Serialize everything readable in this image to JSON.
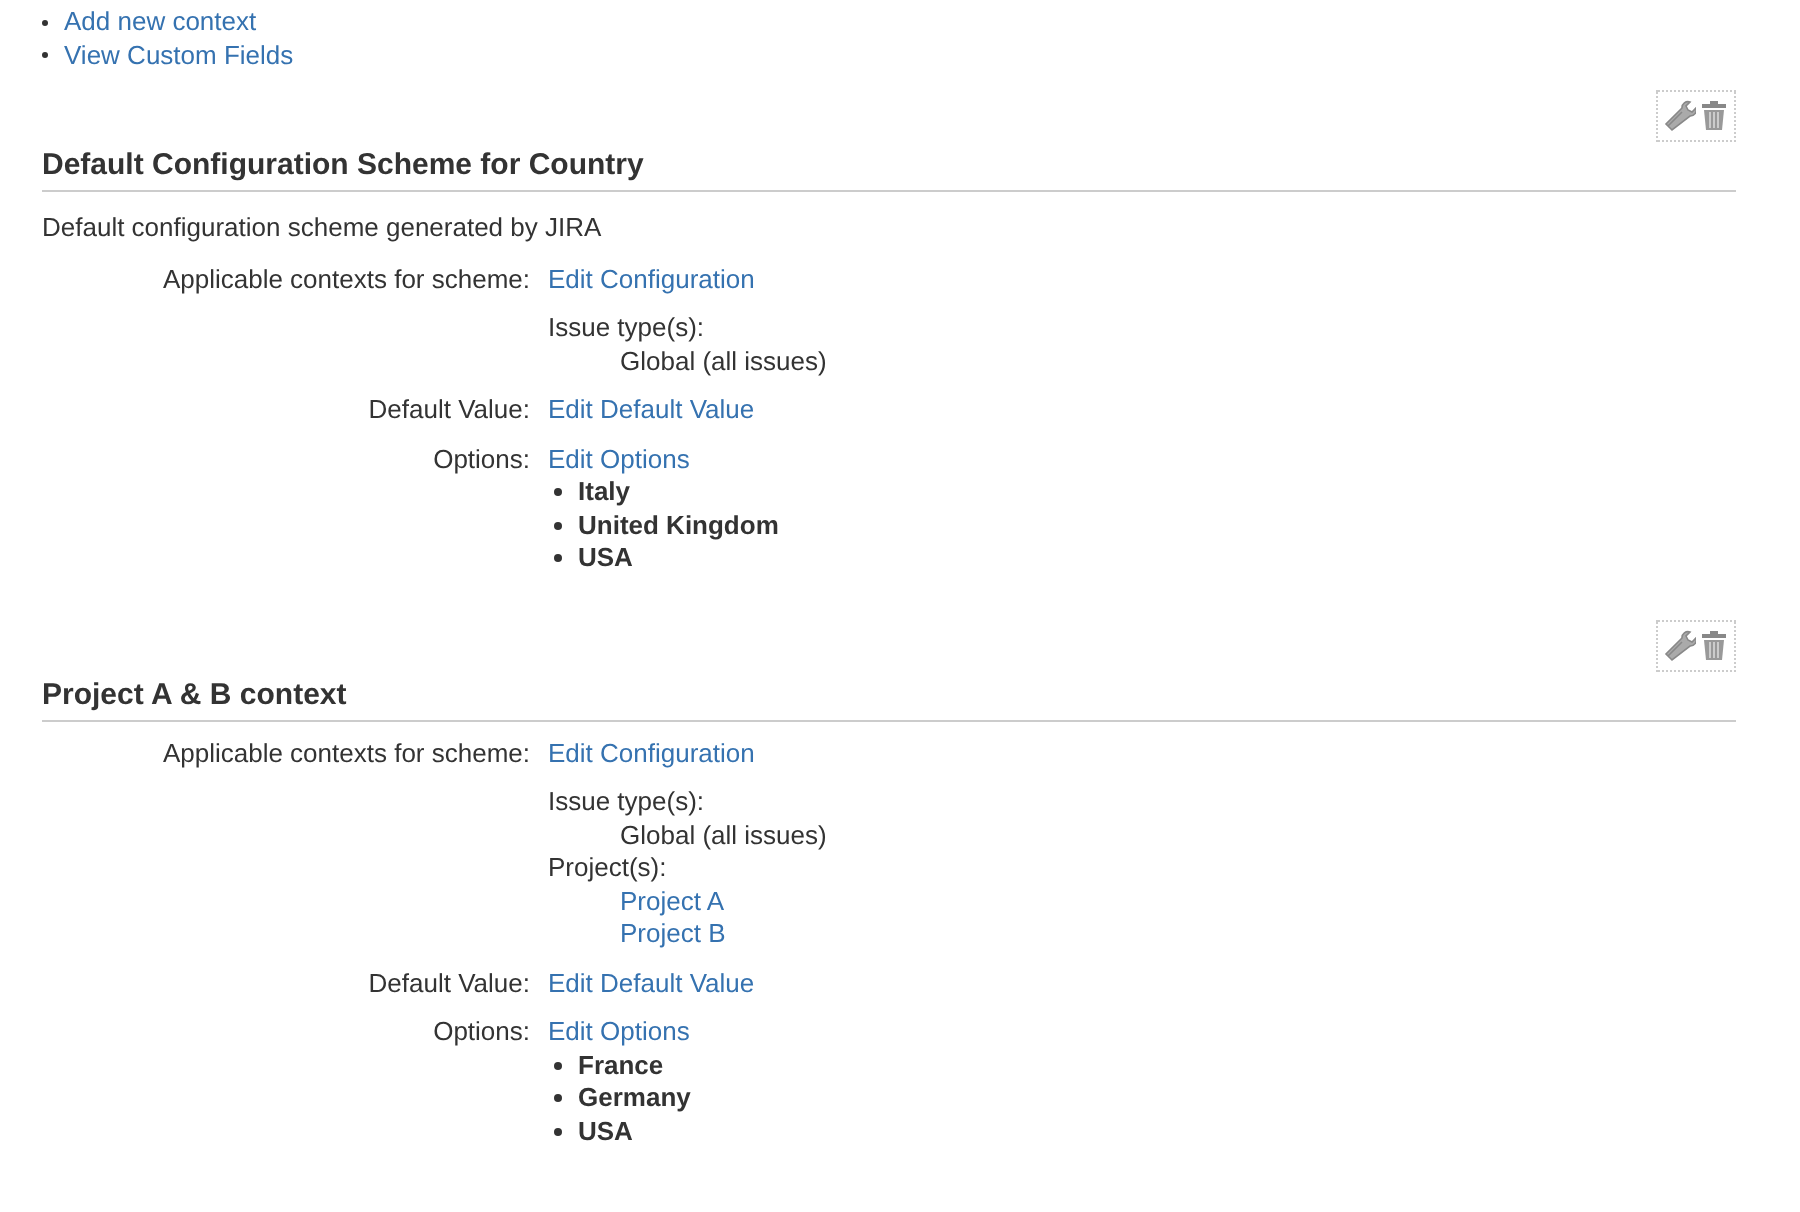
{
  "top_links": [
    "Add new context",
    "View Custom Fields"
  ],
  "schemes": [
    {
      "title": "Default Configuration Scheme for Country",
      "description": "Default configuration scheme generated by JIRA",
      "contexts": {
        "label": "Applicable contexts for scheme:",
        "link": "Edit Configuration",
        "issue_types_label": "Issue type(s):",
        "issue_types": [
          "Global (all issues)"
        ]
      },
      "default_value": {
        "label": "Default Value:",
        "link": "Edit Default Value"
      },
      "options": {
        "label": "Options:",
        "link": "Edit Options",
        "items": [
          "Italy",
          "United Kingdom",
          "USA"
        ]
      }
    },
    {
      "title": "Project A & B context",
      "contexts": {
        "label": "Applicable contexts for scheme:",
        "link": "Edit Configuration",
        "issue_types_label": "Issue type(s):",
        "issue_types": [
          "Global (all issues)"
        ],
        "projects_label": "Project(s):",
        "projects": [
          "Project A",
          "Project B"
        ]
      },
      "default_value": {
        "label": "Default Value:",
        "link": "Edit Default Value"
      },
      "options": {
        "label": "Options:",
        "link": "Edit Options",
        "items": [
          "France",
          "Germany",
          "USA"
        ]
      }
    }
  ]
}
